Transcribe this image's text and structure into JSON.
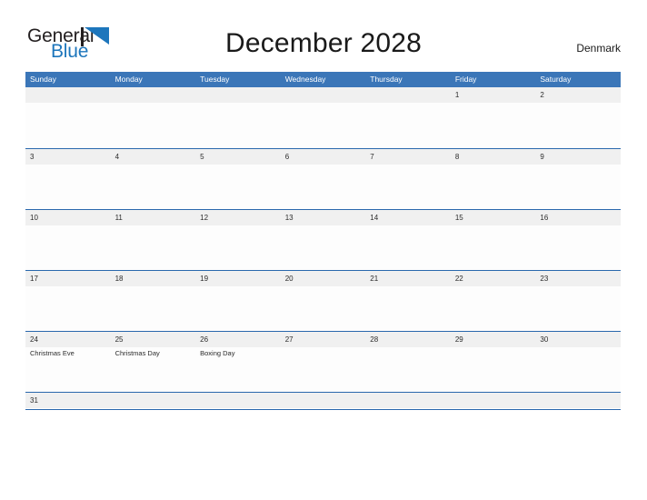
{
  "logo": {
    "word_one": "General",
    "word_two": "Blue",
    "flag_icon": "blue-flag-icon",
    "brand_black": "#231f20",
    "brand_blue": "#1d76bc"
  },
  "header": {
    "title": "December 2028",
    "country": "Denmark"
  },
  "theme": {
    "header_blue": "#3b76b8",
    "rule_blue": "#2a68ad",
    "date_band_gray": "#f0f0f0",
    "cell_white": "#fdfdfd",
    "text_dark": "#2b2b2b"
  },
  "calendar": {
    "month": "December",
    "year": "2028",
    "weekday_headers": [
      "Sunday",
      "Monday",
      "Tuesday",
      "Wednesday",
      "Thursday",
      "Friday",
      "Saturday"
    ],
    "weeks": [
      [
        {
          "day": ""
        },
        {
          "day": ""
        },
        {
          "day": ""
        },
        {
          "day": ""
        },
        {
          "day": ""
        },
        {
          "day": "1",
          "event": ""
        },
        {
          "day": "2",
          "event": ""
        }
      ],
      [
        {
          "day": "3",
          "event": ""
        },
        {
          "day": "4",
          "event": ""
        },
        {
          "day": "5",
          "event": ""
        },
        {
          "day": "6",
          "event": ""
        },
        {
          "day": "7",
          "event": ""
        },
        {
          "day": "8",
          "event": ""
        },
        {
          "day": "9",
          "event": ""
        }
      ],
      [
        {
          "day": "10",
          "event": ""
        },
        {
          "day": "11",
          "event": ""
        },
        {
          "day": "12",
          "event": ""
        },
        {
          "day": "13",
          "event": ""
        },
        {
          "day": "14",
          "event": ""
        },
        {
          "day": "15",
          "event": ""
        },
        {
          "day": "16",
          "event": ""
        }
      ],
      [
        {
          "day": "17",
          "event": ""
        },
        {
          "day": "18",
          "event": ""
        },
        {
          "day": "19",
          "event": ""
        },
        {
          "day": "20",
          "event": ""
        },
        {
          "day": "21",
          "event": ""
        },
        {
          "day": "22",
          "event": ""
        },
        {
          "day": "23",
          "event": ""
        }
      ],
      [
        {
          "day": "24",
          "event": "Christmas Eve"
        },
        {
          "day": "25",
          "event": "Christmas Day"
        },
        {
          "day": "26",
          "event": "Boxing Day"
        },
        {
          "day": "27",
          "event": ""
        },
        {
          "day": "28",
          "event": ""
        },
        {
          "day": "29",
          "event": ""
        },
        {
          "day": "30",
          "event": ""
        }
      ],
      [
        {
          "day": "31",
          "event": ""
        },
        {
          "day": ""
        },
        {
          "day": ""
        },
        {
          "day": ""
        },
        {
          "day": ""
        },
        {
          "day": ""
        },
        {
          "day": ""
        }
      ]
    ]
  }
}
